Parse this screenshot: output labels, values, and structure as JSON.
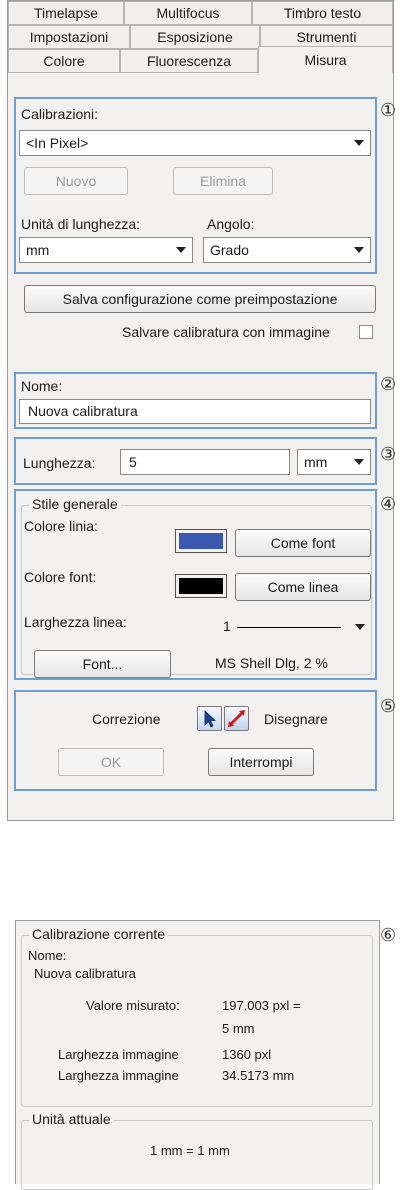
{
  "tabs": {
    "row1": [
      "Timelapse",
      "Multifocus",
      "Timbro testo"
    ],
    "row2": [
      "Impostazioni",
      "Esposizione",
      "Strumenti"
    ],
    "row3": [
      "Colore",
      "Fluorescenza",
      "Misura"
    ],
    "active": "Misura"
  },
  "markers": [
    "①",
    "②",
    "③",
    "④",
    "⑤",
    "⑥"
  ],
  "section1": {
    "calibrations_label": "Calibrazioni:",
    "calibration_value": "<In Pixel>",
    "new_label": "Nuovo",
    "delete_label": "Elimina",
    "length_unit_label": "Unità di lunghezza:",
    "length_unit_value": "mm",
    "angle_label": "Angolo:",
    "angle_value": "Grado"
  },
  "save_preset_label": "Salva configurazione come preimpostazione",
  "save_with_image_label": "Salvare calibratura con immagine",
  "save_with_image_checked": false,
  "section2": {
    "name_label": "Nome:",
    "name_value": "Nuova calibratura"
  },
  "section3": {
    "length_label": "Lunghezza:",
    "length_value": "5",
    "unit_value": "mm"
  },
  "section4": {
    "title": "Stile generale",
    "line_color_label": "Colore linia:",
    "line_color": "#3a58b0",
    "font_like_label": "Come font",
    "font_color_label": "Colore font:",
    "font_color": "#000000",
    "line_like_label": "Come linea",
    "line_width_label": "Larghezza linea:",
    "line_width_value": "1",
    "font_button_label": "Font...",
    "font_info": "MS Shell Dlg, 2 %"
  },
  "section5": {
    "correction_label": "Correzione",
    "draw_label": "Disegnare",
    "ok_label": "OK",
    "interrupt_label": "Interrompi"
  },
  "section6": {
    "title": "Calibrazione corrente",
    "name_label": "Nome:",
    "name_value": "Nuova calibratura",
    "measured_label": "Valore misurato:",
    "measured_value": "197.003 pxl =",
    "measured_value2": "5 mm",
    "image_width_label": "Larghezza immagine",
    "image_width_px": "1360 pxl",
    "image_width_label2": "Larghezza immagine",
    "image_width_mm": "34.5173 mm",
    "unit_title": "Unità attuale",
    "unit_value": "1 mm = 1 mm"
  }
}
